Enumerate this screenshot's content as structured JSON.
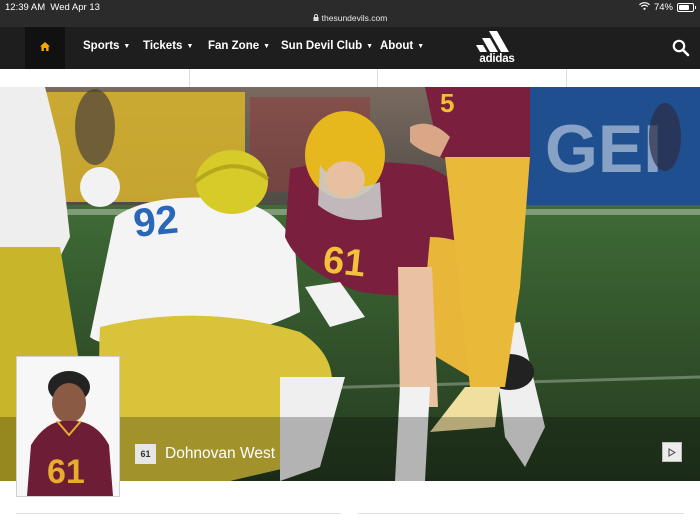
{
  "status_bar": {
    "time": "12:39 AM",
    "date": "Wed Apr 13",
    "url": "thesundevils.com",
    "battery": "74%",
    "battery_level": 0.74,
    "icons": [
      "lock-icon",
      "wifi-icon",
      "battery-icon"
    ]
  },
  "nav": {
    "home_icon": "home-icon",
    "items": [
      {
        "label": "Sports"
      },
      {
        "label": "Tickets"
      },
      {
        "label": "Fan Zone"
      },
      {
        "label": "Sun Devil Club"
      },
      {
        "label": "About"
      }
    ],
    "sponsor_logo_text": "adidas",
    "search_icon": "search-icon"
  },
  "hero": {
    "player_number": "61",
    "player_name": "Dohnovan West",
    "play_icon": "play-icon"
  },
  "colors": {
    "nav_bg": "#1e1e1e",
    "home_accent": "#f5a800",
    "maroon": "#7a1f3d",
    "gold": "#ffc627"
  }
}
